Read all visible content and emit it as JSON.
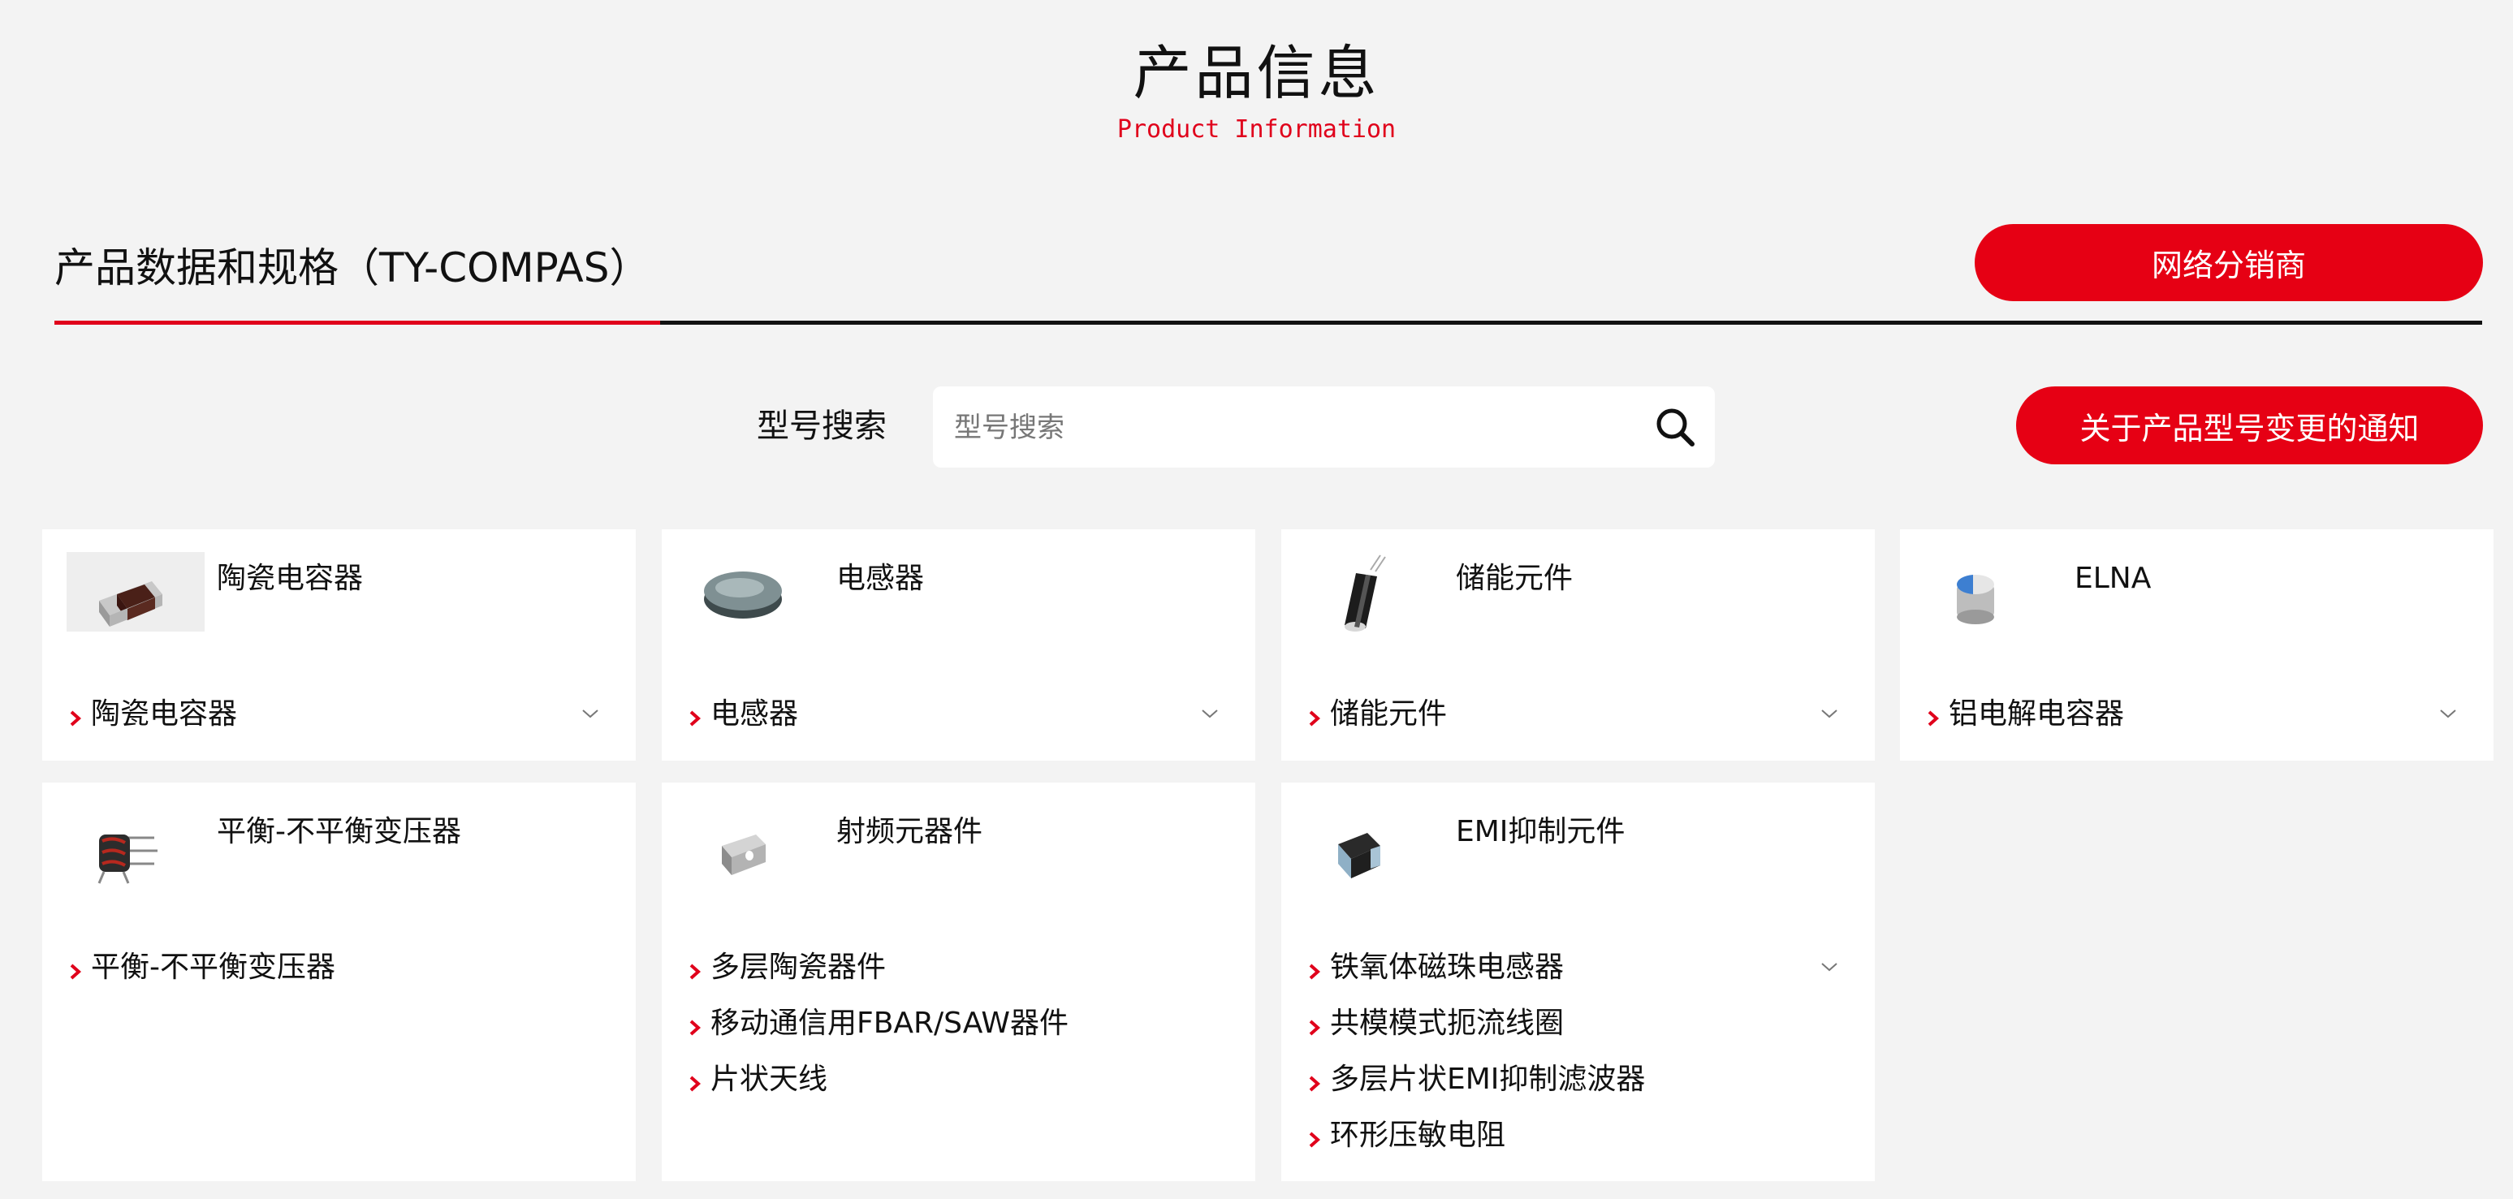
{
  "header": {
    "title": "产品信息",
    "subtitle": "Product Information"
  },
  "section": {
    "title": "产品数据和规格（TY-COMPAS）",
    "distributor_button": "网络分销商",
    "notice_button": "关于产品型号变更的通知"
  },
  "search": {
    "label": "型号搜索",
    "placeholder": "型号搜索",
    "value": ""
  },
  "colors": {
    "accent": "#e60014",
    "background": "#f3f3f3",
    "card": "#ffffff"
  },
  "cards": [
    {
      "title": "陶瓷电容器",
      "icon": "ceramic-capacitor-image",
      "items": [
        {
          "label": "陶瓷电容器",
          "expandable": true
        }
      ]
    },
    {
      "title": "电感器",
      "icon": "inductor-image",
      "items": [
        {
          "label": "电感器",
          "expandable": true
        }
      ]
    },
    {
      "title": "储能元件",
      "icon": "energy-storage-image",
      "items": [
        {
          "label": "储能元件",
          "expandable": true
        }
      ]
    },
    {
      "title": "ELNA",
      "icon": "elna-capacitor-image",
      "items": [
        {
          "label": "铝电解电容器",
          "expandable": true
        }
      ]
    },
    {
      "title": "平衡-不平衡变压器",
      "icon": "balun-transformer-image",
      "items": [
        {
          "label": "平衡-不平衡变压器",
          "expandable": false
        }
      ]
    },
    {
      "title": "射频元器件",
      "icon": "rf-component-image",
      "items": [
        {
          "label": "多层陶瓷器件",
          "expandable": false
        },
        {
          "label": "移动通信用FBAR/SAW器件",
          "expandable": false
        },
        {
          "label": "片状天线",
          "expandable": false
        }
      ]
    },
    {
      "title": "EMI抑制元件",
      "icon": "emi-component-image",
      "items": [
        {
          "label": "铁氧体磁珠电感器",
          "expandable": true
        },
        {
          "label": "共模模式扼流线圈",
          "expandable": false
        },
        {
          "label": "多层片状EMI抑制滤波器",
          "expandable": false
        },
        {
          "label": "环形压敏电阻",
          "expandable": false
        }
      ]
    }
  ]
}
